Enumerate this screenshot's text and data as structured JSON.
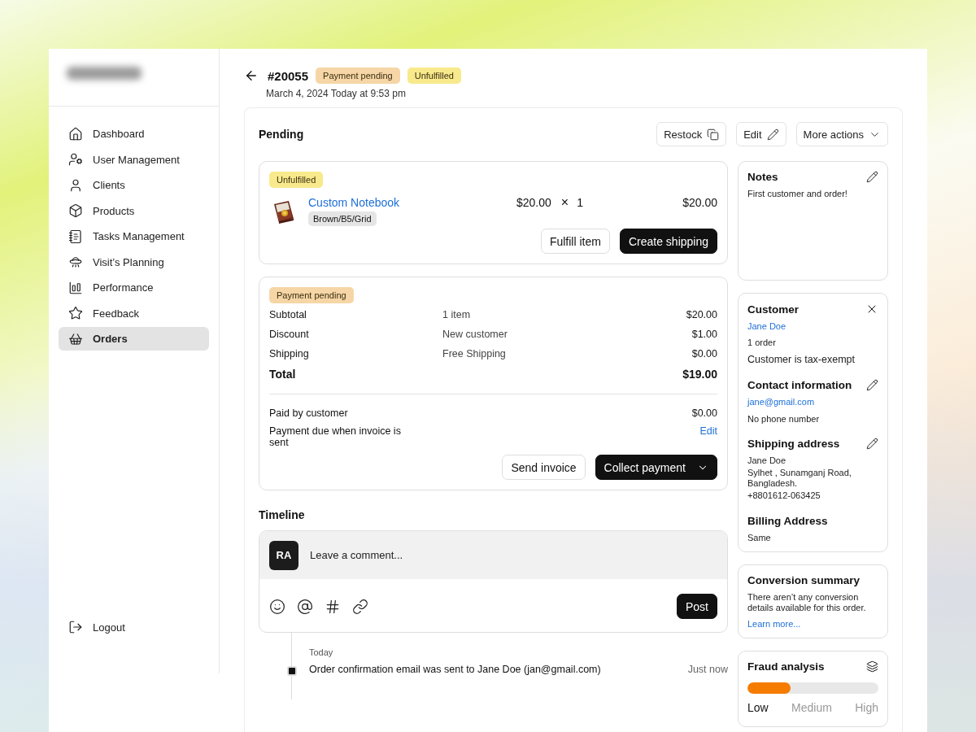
{
  "sidebar": {
    "items": [
      {
        "label": "Dashboard",
        "selected": false
      },
      {
        "label": "User Management",
        "selected": false
      },
      {
        "label": "Clients",
        "selected": false
      },
      {
        "label": "Products",
        "selected": false
      },
      {
        "label": "Tasks Management",
        "selected": false
      },
      {
        "label": "Visit’s Planning",
        "selected": false
      },
      {
        "label": "Performance",
        "selected": false
      },
      {
        "label": "Feedback",
        "selected": false
      },
      {
        "label": "Orders",
        "selected": true
      }
    ],
    "logout": "Logout"
  },
  "header": {
    "order": "#20055",
    "badges": [
      {
        "label": "Payment pending",
        "color": "#f6d6a6"
      },
      {
        "label": "Unfulfilled",
        "color": "#f8ea8c"
      }
    ],
    "date": "March 4, 2024 Today at 9:53 pm"
  },
  "panel": {
    "title": "Pending",
    "actions": [
      {
        "label": "Restock"
      },
      {
        "label": "Edit"
      },
      {
        "label": "More actions"
      }
    ]
  },
  "item_card": {
    "badge": {
      "label": "Unfulfilled",
      "color": "#f8ea8c"
    },
    "product": {
      "kind": "picture",
      "name": "Custom Notebook",
      "variant": "Brown/B5/Grid",
      "price": "$20.00",
      "times": "×",
      "quantity": "1",
      "total": "$20.00"
    },
    "buttons": [
      {
        "label": "Fulfill item",
        "kind": "secondary"
      },
      {
        "label": "Create shipping",
        "kind": "primary"
      }
    ]
  },
  "payment_card": {
    "badge": {
      "label": "Payment pending",
      "color": "#f6d6a6"
    },
    "rows": [
      {
        "kind": "line",
        "label": "Subtotal",
        "detail": "1 item",
        "amount": "$20.00"
      },
      {
        "kind": "line",
        "label": "Discount",
        "detail": "New customer",
        "amount": "$1.00"
      },
      {
        "kind": "line",
        "label": "Shipping",
        "detail": "Free Shipping",
        "amount": "$0.00"
      },
      {
        "kind": "total",
        "label": "Total",
        "amount": "$19.00"
      }
    ],
    "status_rows": [
      {
        "kind": "amount",
        "label": "Paid by customer",
        "value": "$0.00"
      },
      {
        "kind": "link",
        "label": "Payment due when invoice is sent",
        "value": "Edit"
      }
    ],
    "buttons": [
      {
        "label": "Send invoice",
        "kind": "secondary"
      },
      {
        "label": "Collect payment",
        "kind": "primary"
      }
    ]
  },
  "timeline": {
    "title": "Timeline",
    "avatar": "RA",
    "placeholder": "Leave a comment...",
    "post": "Post",
    "day": "Today",
    "events": [
      {
        "text": "Order confirmation email was sent to Jane Doe (jan@gmail.com)",
        "time": "Just now"
      }
    ]
  },
  "notes": {
    "title": "Notes",
    "text": "First customer and order!"
  },
  "customer": {
    "sections": [
      {
        "title": "Customer",
        "lines": [
          {
            "kind": "link",
            "text": "Jane Doe"
          },
          {
            "kind": "plain",
            "text": "1 order"
          },
          {
            "kind": "strong",
            "text": "Customer is tax-exempt"
          }
        ]
      },
      {
        "title": "Contact information",
        "lines": [
          {
            "kind": "link",
            "text": "jane@gmail.com"
          },
          {
            "kind": "plain",
            "text": "No phone number"
          }
        ]
      },
      {
        "title": "Shipping address",
        "lines": [
          {
            "kind": "plain",
            "text": "Jane Doe"
          },
          {
            "kind": "tight",
            "text": "Sylhet , Sunamganj Road, Bangladesh."
          },
          {
            "kind": "tight",
            "text": "+8801612-063425"
          }
        ]
      },
      {
        "title": "Billing Address",
        "lines": [
          {
            "kind": "plain",
            "text": "Same"
          }
        ]
      }
    ]
  },
  "conversion": {
    "title": "Conversion summary",
    "text": "There aren’t any conversion details available for this order.",
    "link": "Learn more..."
  },
  "fraud": {
    "title": "Fraud analysis",
    "level": 0.33,
    "levels": [
      {
        "label": "Low",
        "selected": true
      },
      {
        "label": "Medium",
        "selected": false
      },
      {
        "label": "High",
        "selected": false
      }
    ]
  }
}
